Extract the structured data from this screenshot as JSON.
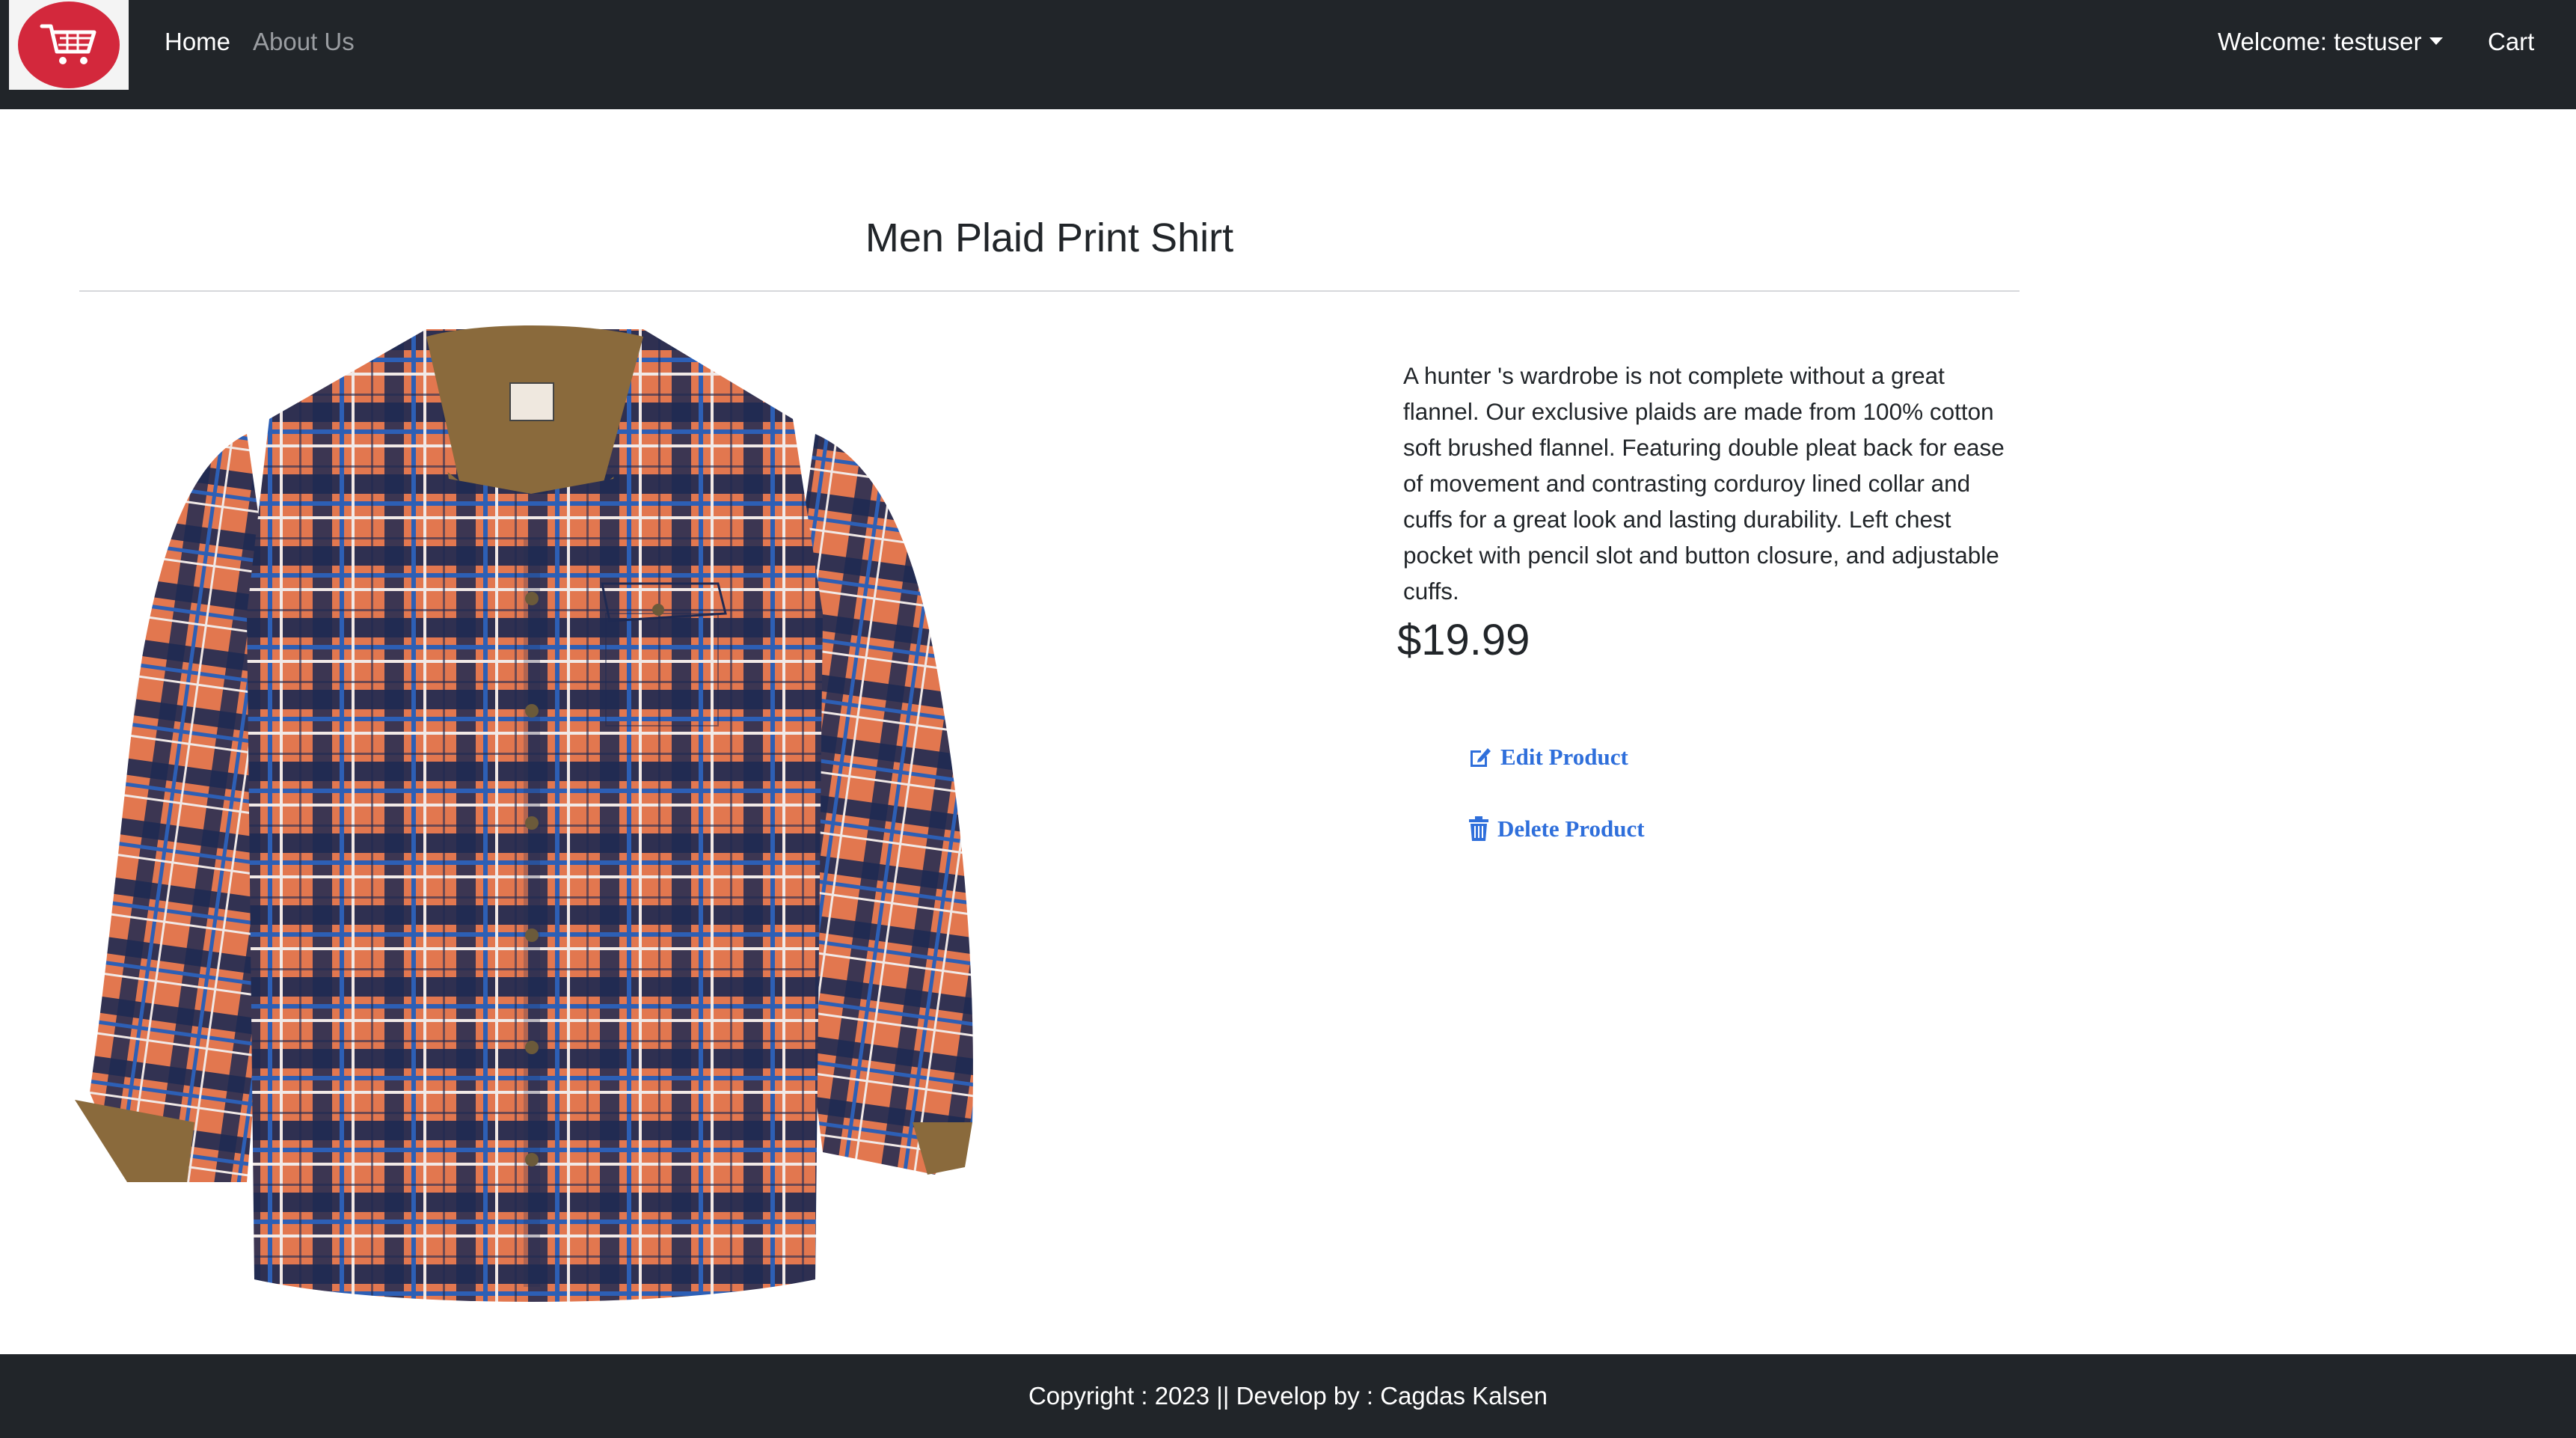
{
  "navbar": {
    "logo_icon": "shopping-cart-icon",
    "home_label": "Home",
    "about_label": "About Us",
    "welcome_label": "Welcome: testuser",
    "cart_label": "Cart"
  },
  "product": {
    "title": "Men Plaid Print Shirt",
    "description": "A hunter 's wardrobe is not complete without a great flannel. Our exclusive plaids are made from 100% cotton soft brushed flannel. Featuring double pleat back for ease of movement and contrasting corduroy lined collar and cuffs for a great look and lasting durability. Left chest pocket with pencil slot and button closure, and adjustable cuffs.",
    "price": "$19.99",
    "image_icon": "plaid-shirt-image"
  },
  "actions": {
    "edit_label": "Edit Product",
    "edit_icon": "edit-icon",
    "delete_label": "Delete Product",
    "delete_icon": "trash-icon"
  },
  "footer": {
    "text": "Copyright : 2023 || Develop by : Cagdas Kalsen"
  },
  "colors": {
    "navbar_bg": "#212529",
    "logo_red": "#d3283c",
    "link_blue": "#2f6fdb",
    "shirt_orange": "#e0764e",
    "shirt_navy": "#1f2a52"
  }
}
